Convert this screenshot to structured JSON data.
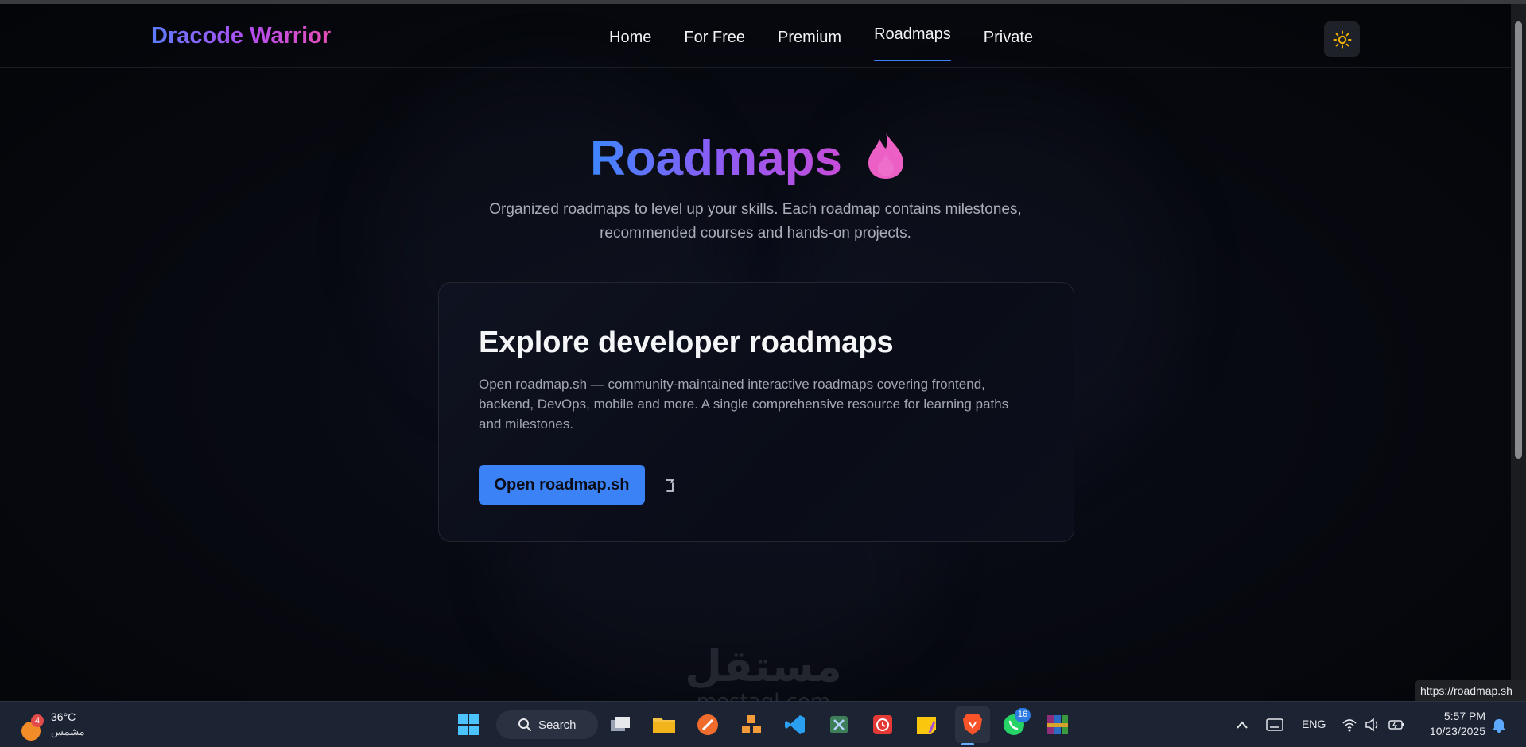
{
  "site": {
    "brand": "Dracode Warrior",
    "nav": [
      "Home",
      "For Free",
      "Premium",
      "Roadmaps",
      "Private"
    ],
    "active_nav": "Roadmaps"
  },
  "hero": {
    "title": "Roadmaps",
    "subtitle_line1": "Organized roadmaps to level up your skills. Each roadmap contains milestones,",
    "subtitle_line2": "recommended courses and hands-on projects."
  },
  "card": {
    "heading": "Explore developer roadmaps",
    "description": "Open roadmap.sh — community-maintained interactive roadmaps covering frontend, backend, DevOps, mobile and more. A single comprehensive resource for learning paths and milestones.",
    "button_label": "Open roadmap.sh"
  },
  "browser": {
    "status_url": "https://roadmap.sh"
  },
  "taskbar": {
    "weather_temp": "36°C",
    "weather_condition": "مشمس",
    "weather_badge": "4",
    "search_label": "Search",
    "whatsapp_badge": "16",
    "language": "ENG",
    "time": "5:57 PM",
    "date": "10/23/2025"
  },
  "watermark": {
    "arabic": "مستقل",
    "latin": "mostaql.com"
  },
  "colors": {
    "accent": "#3b82f6",
    "background": "#050608",
    "taskbar": "#1c2333"
  }
}
